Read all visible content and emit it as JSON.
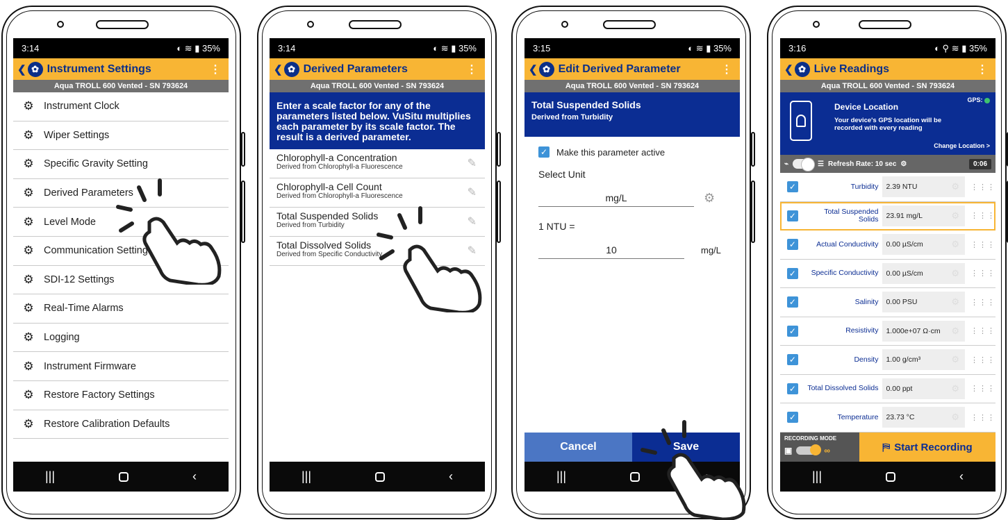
{
  "status": {
    "phone1_time": "3:14",
    "phone2_time": "3:14",
    "phone3_time": "3:15",
    "phone4_time": "3:16",
    "battery": "35%"
  },
  "device_name": "Aqua TROLL 600 Vented - SN 793624",
  "screen1": {
    "title": "Instrument Settings",
    "items": [
      "Instrument Clock",
      "Wiper Settings",
      "Specific Gravity Setting",
      "Derived Parameters",
      "Level Mode",
      "Communication Settings",
      "SDI-12 Settings",
      "Real-Time Alarms",
      "Logging",
      "Instrument Firmware",
      "Restore Factory Settings",
      "Restore Calibration Defaults"
    ]
  },
  "screen2": {
    "title": "Derived Parameters",
    "banner": "Enter a scale factor for any of the parameters listed below. VuSitu multiplies each parameter by its scale factor. The result is a derived parameter.",
    "params": [
      {
        "name": "Chlorophyll-a Concentration",
        "sub": "Derived from Chlorophyll-a Fluorescence"
      },
      {
        "name": "Chlorophyll-a Cell Count",
        "sub": "Derived from Chlorophyll-a Fluorescence"
      },
      {
        "name": "Total Suspended Solids",
        "sub": "Derived from Turbidity"
      },
      {
        "name": "Total Dissolved Solids",
        "sub": "Derived from Specific Conductivity"
      }
    ]
  },
  "screen3": {
    "title": "Edit Derived Parameter",
    "param_name": "Total Suspended Solids",
    "derived_from": "Derived from Turbidity",
    "active_label": "Make this parameter active",
    "select_unit_label": "Select Unit",
    "unit_value": "mg/L",
    "ntu_label": "1 NTU =",
    "factor_value": "10",
    "factor_unit": "mg/L",
    "cancel": "Cancel",
    "save": "Save"
  },
  "screen4": {
    "title": "Live Readings",
    "loc_title": "Device Location",
    "loc_text": "Your device's GPS location will be recorded with every reading",
    "gps_label": "GPS:",
    "change_location": "Change Location >",
    "refresh_rate": "Refresh Rate: 10 sec",
    "timer": "0:06",
    "readings": [
      {
        "name": "Turbidity",
        "value": "2.39 NTU"
      },
      {
        "name": "Total Suspended Solids",
        "value": "23.91 mg/L"
      },
      {
        "name": "Actual Conductivity",
        "value": "0.00 µS/cm"
      },
      {
        "name": "Specific Conductivity",
        "value": "0.00 µS/cm"
      },
      {
        "name": "Salinity",
        "value": "0.00 PSU"
      },
      {
        "name": "Resistivity",
        "value": "1.000e+07 Ω·cm"
      },
      {
        "name": "Density",
        "value": "1.00 g/cm³"
      },
      {
        "name": "Total Dissolved Solids",
        "value": "0.00 ppt"
      },
      {
        "name": "Temperature",
        "value": "23.73 °C"
      }
    ],
    "recording_mode": "RECORDING MODE",
    "start_recording": "Start Recording"
  },
  "colors": {
    "accent": "#f8b534",
    "brand_blue": "#0b2d93",
    "cancel_blue": "#4b76c4"
  }
}
